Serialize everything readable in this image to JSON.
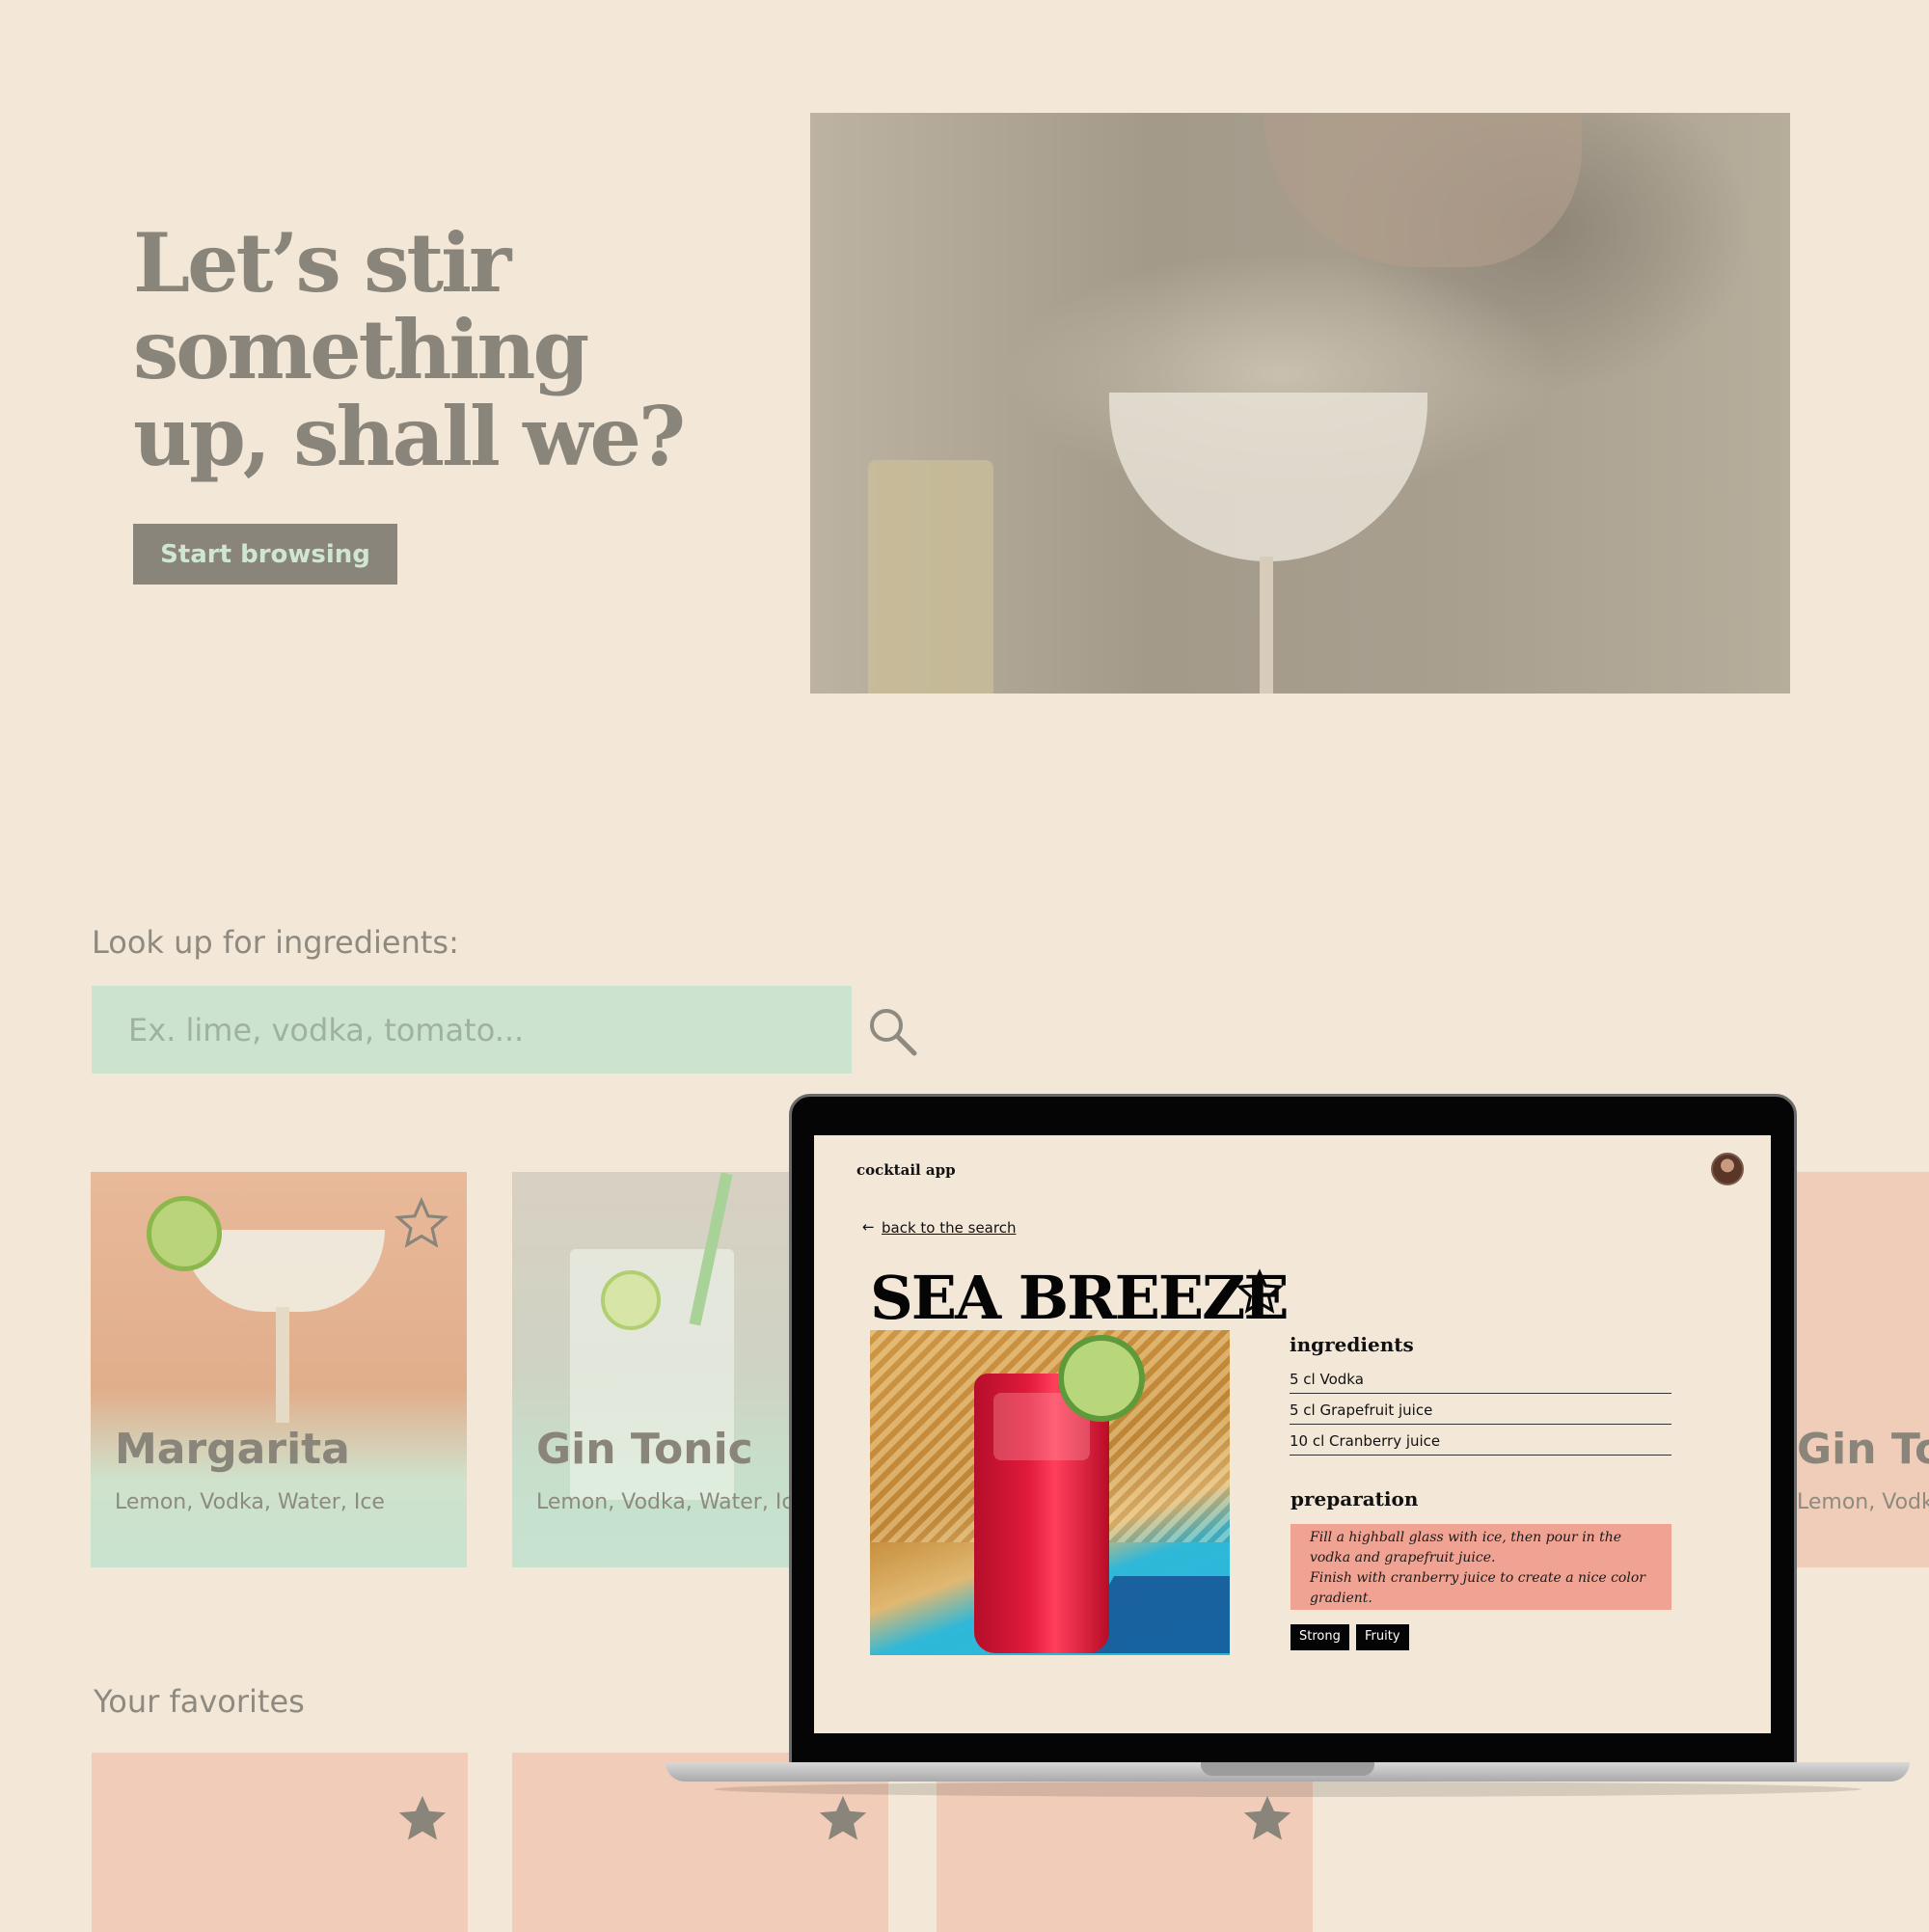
{
  "hero": {
    "title": "Let’s stir something up, shall we?",
    "cta_label": "Start browsing"
  },
  "search": {
    "label": "Look up for ingredients:",
    "placeholder": "Ex. lime, vodka, tomato..."
  },
  "cards": [
    {
      "name": "Margarita",
      "ingredients": "Lemon, Vodka, Water, Ice"
    },
    {
      "name": "Gin Tonic",
      "ingredients": "Lemon, Vodka, Water, Ice"
    },
    {
      "name": "Gin Tonic",
      "ingredients": "Lemon, Vodka, Water, Ice"
    }
  ],
  "favorites": {
    "label": "Your favorites"
  },
  "app": {
    "brand": "cocktail app",
    "back_link": "back to the search",
    "drink_title": "SEA BREEZE",
    "ingredients_heading": "ingredients",
    "ingredients": [
      "5 cl Vodka",
      "5 cl Grapefruit juice",
      "10 cl Cranberry juice"
    ],
    "preparation_heading": "preparation",
    "preparation_lines": [
      "Fill a highball glass with ice, then pour in the",
      "vodka and grapefruit juice.",
      "Finish with cranberry juice to create a nice color",
      "gradient."
    ],
    "tags": [
      "Strong",
      "Fruity"
    ]
  },
  "colors": {
    "background": "#f3e8d8",
    "mint": "#cce3d0",
    "peach": "#f1ccb8",
    "prep_salmon": "#f0a392",
    "muted_text": "#8a857a"
  }
}
